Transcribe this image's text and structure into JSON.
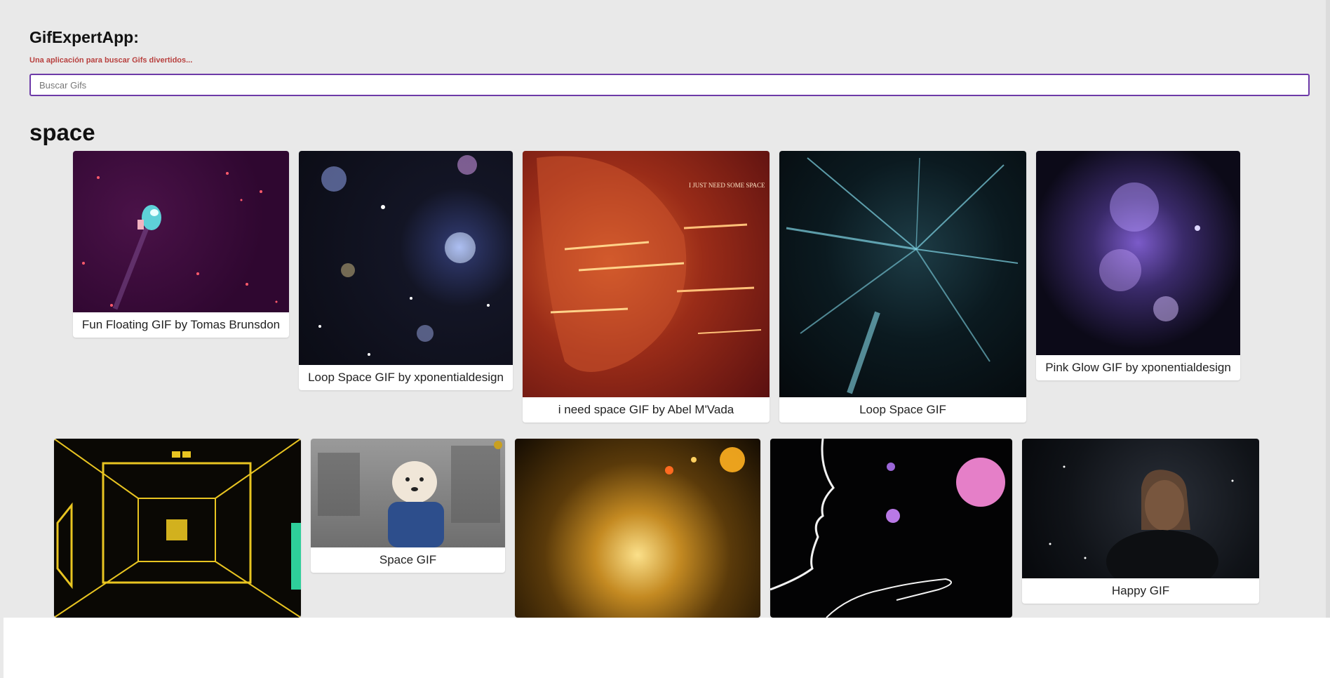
{
  "header": {
    "title": "GifExpertApp:",
    "subtitle": "Una aplicación para buscar Gifs divertidos..."
  },
  "search": {
    "placeholder": "Buscar Gifs",
    "value": ""
  },
  "category": {
    "title": "space"
  },
  "gifs": [
    {
      "title": "Fun Floating GIF by Tomas Brunsdon"
    },
    {
      "title": "Loop Space GIF by xponentialdesign"
    },
    {
      "title": "i need space GIF by Abel M'Vada",
      "image_text": "I JUST NEED SOME SPACE"
    },
    {
      "title": "Loop Space GIF"
    },
    {
      "title": "Pink Glow GIF by xponentialdesign"
    },
    {
      "title": ""
    },
    {
      "title": "Space GIF"
    },
    {
      "title": ""
    },
    {
      "title": ""
    },
    {
      "title": "Happy GIF"
    }
  ],
  "colors": {
    "background": "#e9e9e9",
    "accent": "#6d3aa8",
    "subtitle": "#b8413f"
  }
}
